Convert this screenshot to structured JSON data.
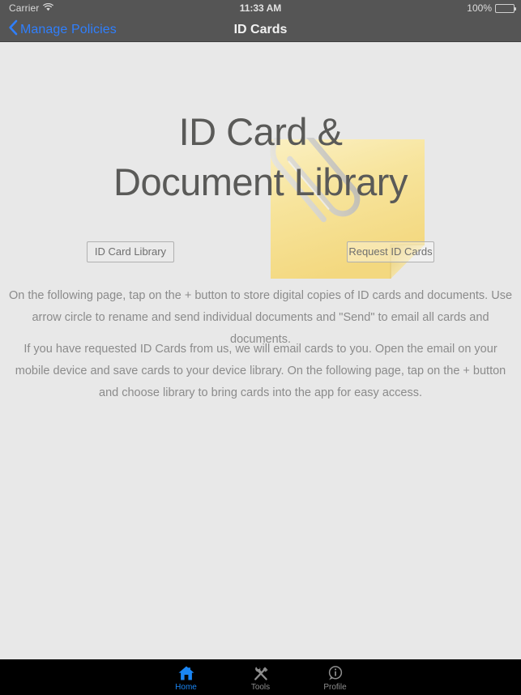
{
  "status_bar": {
    "carrier": "Carrier",
    "wifi_icon": "wifi-icon",
    "time": "11:33 AM",
    "battery_percent": "100%",
    "battery_icon": "battery-full-icon"
  },
  "nav_bar": {
    "back_icon": "chevron-left-icon",
    "back_label": "Manage Policies",
    "title": "ID Cards"
  },
  "hero": {
    "title": "ID Card &\nDocument Library",
    "artwork_icon": "sticky-note-with-paperclip-icon"
  },
  "buttons": {
    "id_card_library": "ID Card Library",
    "request_id_cards": "Request ID Cards"
  },
  "paragraphs": {
    "first": "On the following page, tap on the + button to store digital copies of ID cards and documents.  Use arrow circle to rename and send individual documents and \"Send\" to email all cards and documents.",
    "second": "If you have requested ID Cards from us, we will email cards to you.  Open the email on your mobile device and save cards to your device library.  On the following page, tap on the + button and choose library to bring cards into the app for easy access."
  },
  "tab_bar": {
    "items": [
      {
        "label": "Home",
        "icon": "home-icon",
        "active": true
      },
      {
        "label": "Tools",
        "icon": "tools-icon",
        "active": false
      },
      {
        "label": "Profile",
        "icon": "info-bubble-icon",
        "active": false
      }
    ]
  },
  "colors": {
    "accent_blue": "#1a86f5",
    "nav_link_blue": "#2f7ffd",
    "background": "#e8e8e8",
    "chrome_gray": "#555555",
    "note_yellow": "#f7e7a4",
    "tab_bar_black": "#000000"
  }
}
